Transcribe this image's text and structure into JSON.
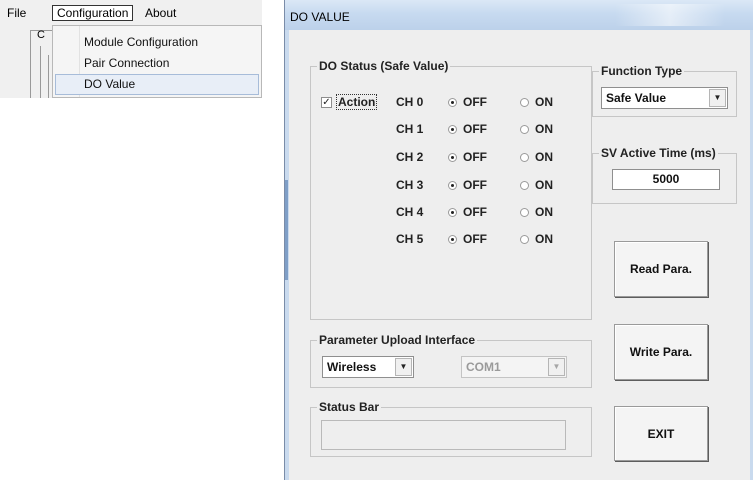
{
  "menubar": {
    "file": "File",
    "configuration": "Configuration",
    "about": "About"
  },
  "background_window": {
    "partial_char": "C"
  },
  "config_menu": {
    "items": [
      "Module Configuration",
      "Pair Connection",
      "DO Value"
    ],
    "highlighted": "DO Value"
  },
  "dialog": {
    "title": "DO VALUE",
    "do_status": {
      "label": "DO Status (Safe Value)",
      "action_label": "Action",
      "action_checked": true,
      "check_glyph": "✓",
      "channels": [
        {
          "name": "CH 0",
          "off": "OFF",
          "on": "ON",
          "selected": "OFF"
        },
        {
          "name": "CH 1",
          "off": "OFF",
          "on": "ON",
          "selected": "OFF"
        },
        {
          "name": "CH 2",
          "off": "OFF",
          "on": "ON",
          "selected": "OFF"
        },
        {
          "name": "CH 3",
          "off": "OFF",
          "on": "ON",
          "selected": "OFF"
        },
        {
          "name": "CH 4",
          "off": "OFF",
          "on": "ON",
          "selected": "OFF"
        },
        {
          "name": "CH 5",
          "off": "OFF",
          "on": "ON",
          "selected": "OFF"
        }
      ]
    },
    "function_type": {
      "label": "Function Type",
      "value": "Safe Value"
    },
    "sv_active_time": {
      "label": "SV Active Time (ms)",
      "value": "5000"
    },
    "param_upload": {
      "label": "Parameter Upload Interface",
      "interface": "Wireless",
      "port": "COM1"
    },
    "status_bar": {
      "label": "Status Bar",
      "text": ""
    },
    "buttons": {
      "read": "Read Para.",
      "write": "Write Para.",
      "exit": "EXIT"
    },
    "arrow_glyph": "▼"
  }
}
